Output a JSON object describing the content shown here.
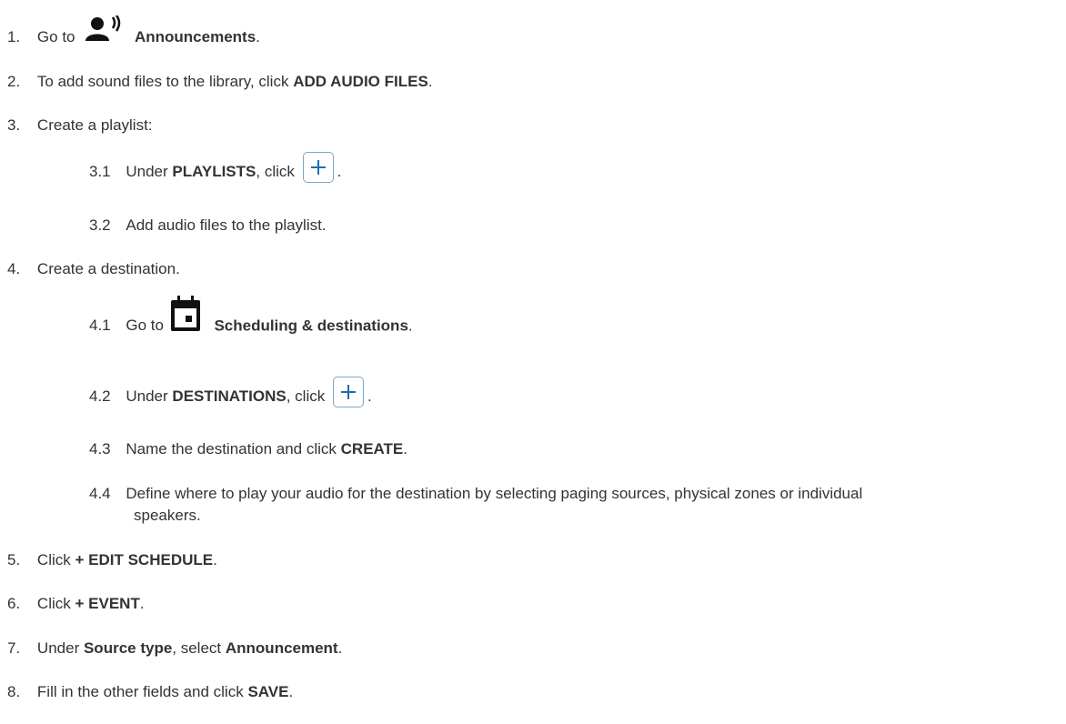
{
  "steps": [
    {
      "num": "1.",
      "prefix": "Go to",
      "icon": "announcements-icon",
      "bold": "Announcements",
      "suffix": "."
    },
    {
      "num": "2.",
      "prefix": "To add sound files to the library, click",
      "bold": "ADD AUDIO FILES",
      "suffix": "."
    },
    {
      "num": "3.",
      "text": "Create a playlist:"
    },
    {
      "num": "3.1",
      "prefix": "Under",
      "bold": "PLAYLISTS",
      "mid": ", click",
      "button": "add-button",
      "suffix": "."
    },
    {
      "num": "3.2",
      "text": "Add audio files to the playlist."
    },
    {
      "num": "4.",
      "text": "Create a destination."
    },
    {
      "num": "4.1",
      "prefix": "Go to",
      "icon": "calendar-icon",
      "bold": "Scheduling & destinations",
      "suffix": "."
    },
    {
      "num": "4.2",
      "prefix": "Under",
      "bold": "DESTINATIONS",
      "mid": ", click",
      "button": "add-button",
      "suffix": "."
    },
    {
      "num": "4.3",
      "prefix": "Name the destination and click",
      "bold": "CREATE",
      "suffix": "."
    },
    {
      "num": "4.4",
      "text": "Define where to play your audio for the destination by selecting paging sources, physical zones or individual",
      "text2": "speakers."
    },
    {
      "num": "5.",
      "prefix": "Click",
      "bold": "+ EDIT SCHEDULE",
      "suffix": "."
    },
    {
      "num": "6.",
      "prefix": "Click",
      "bold": "+ EVENT",
      "suffix": "."
    },
    {
      "num": "7.",
      "prefix": "Under",
      "bold": "Source type",
      "mid": ", select",
      "bold2": "Announcement",
      "suffix": "."
    },
    {
      "num": "8.",
      "prefix": "Fill in the other fields and click",
      "bold": "SAVE",
      "suffix": "."
    }
  ]
}
